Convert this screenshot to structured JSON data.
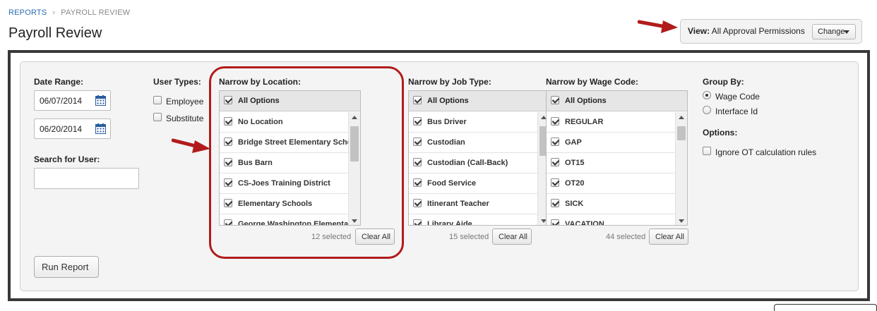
{
  "breadcrumb": {
    "root": "REPORTS",
    "sep": "›",
    "current": "PAYROLL REVIEW"
  },
  "page_title": "Payroll Review",
  "view": {
    "label": "View:",
    "value": "All Approval Permissions",
    "change_label": "Change"
  },
  "date_range": {
    "label": "Date Range:",
    "start": "06/07/2014",
    "end": "06/20/2014"
  },
  "search": {
    "label": "Search for User:",
    "value": ""
  },
  "user_types": {
    "label": "User Types:",
    "options": [
      "Employee",
      "Substitute"
    ]
  },
  "location": {
    "label": "Narrow by Location:",
    "all_label": "All Options",
    "items": [
      "No Location",
      "Bridge Street Elementary School",
      "Bus Barn",
      "CS-Joes Training District",
      "Elementary Schools",
      "George Washington Elementary"
    ],
    "selected_text": "12 selected",
    "clear_label": "Clear All"
  },
  "job_type": {
    "label": "Narrow by Job Type:",
    "all_label": "All Options",
    "items": [
      "Bus Driver",
      "Custodian",
      "Custodian (Call-Back)",
      "Food Service",
      "Itinerant Teacher",
      "Library Aide"
    ],
    "selected_text": "15 selected",
    "clear_label": "Clear All"
  },
  "wage_code": {
    "label": "Narrow by Wage Code:",
    "all_label": "All Options",
    "items": [
      "REGULAR",
      "GAP",
      "OT15",
      "OT20",
      "SICK",
      "VACATION"
    ],
    "selected_text": "44 selected",
    "clear_label": "Clear All"
  },
  "group_by": {
    "label": "Group By:",
    "options": [
      "Wage Code",
      "Interface Id"
    ],
    "selected": "Wage Code"
  },
  "options": {
    "label": "Options:",
    "ignore_ot": "Ignore OT calculation rules"
  },
  "run_report_label": "Run Report",
  "colors": {
    "highlight": "#b21b1b",
    "link": "#2b6cb0",
    "frame": "#383838"
  }
}
